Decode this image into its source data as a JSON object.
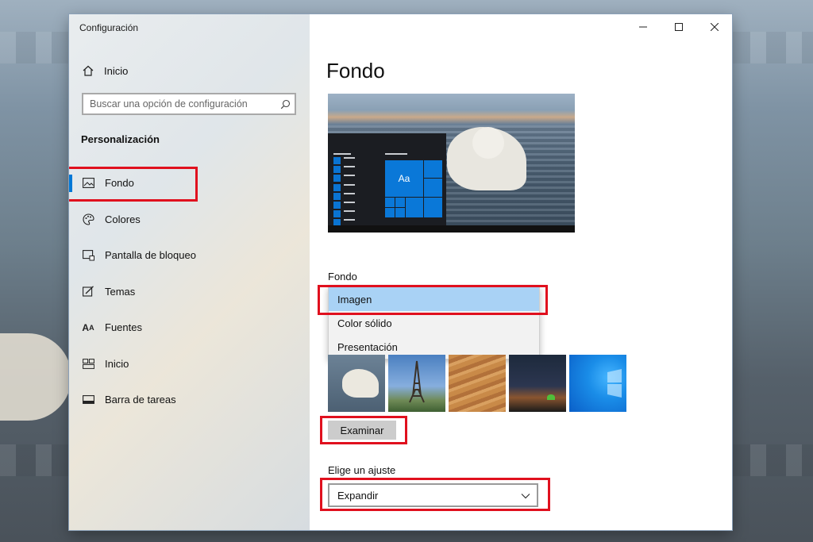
{
  "window": {
    "title": "Configuración"
  },
  "sidebar": {
    "home_label": "Inicio",
    "search_placeholder": "Buscar una opción de configuración",
    "section_title": "Personalización",
    "items": [
      {
        "label": "Fondo",
        "icon": "image-icon",
        "active": true
      },
      {
        "label": "Colores",
        "icon": "palette-icon",
        "active": false
      },
      {
        "label": "Pantalla de bloqueo",
        "icon": "lock-screen-icon",
        "active": false
      },
      {
        "label": "Temas",
        "icon": "themes-icon",
        "active": false
      },
      {
        "label": "Fuentes",
        "icon": "fonts-icon",
        "active": false
      },
      {
        "label": "Inicio",
        "icon": "start-icon",
        "active": false
      },
      {
        "label": "Barra de tareas",
        "icon": "taskbar-icon",
        "active": false
      }
    ]
  },
  "main": {
    "title": "Fondo",
    "preview": {
      "tile_label": "Aa"
    },
    "background_label": "Fondo",
    "background_options": [
      {
        "label": "Imagen",
        "selected": true
      },
      {
        "label": "Color sólido",
        "selected": false
      },
      {
        "label": "Presentación",
        "selected": false
      }
    ],
    "browse_label": "Examinar",
    "fit_label": "Elige un ajuste",
    "fit_value": "Expandir"
  },
  "colors": {
    "accent": "#0078d7",
    "highlight": "#e0101e",
    "selected_option": "#a9d2f5"
  }
}
